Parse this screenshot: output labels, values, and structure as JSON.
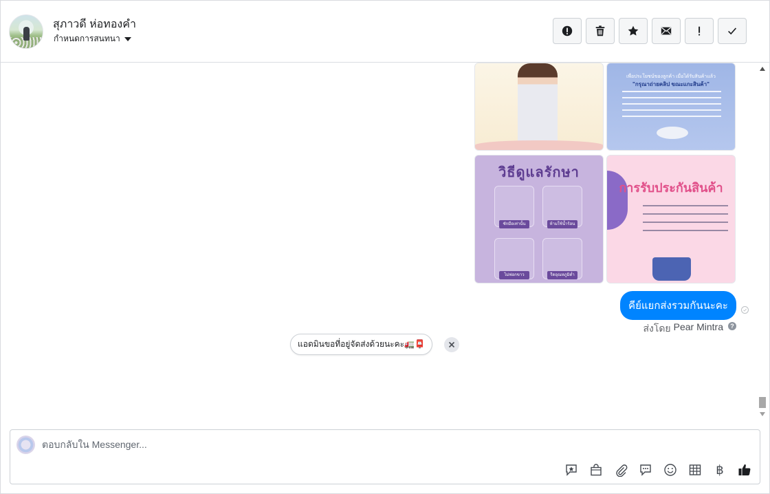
{
  "header": {
    "name": "สุภาวดี ห่อทองคำ",
    "subtitle": "กำหนดการสนทนา",
    "actions": [
      "info-icon",
      "trash-icon",
      "star-icon",
      "mail-icon",
      "exclamation-icon",
      "check-icon"
    ]
  },
  "conversation": {
    "images": {
      "img2_line1": "เพื่อประโยชน์ของลูกค้า เมื่อได้รับสินค้าแล้ว",
      "img2_line2": "\"กรุณาถ่ายคลิป ขณะแกะสินค้า\"",
      "img3_title": "วิธีดูแลรักษา",
      "img3_tags": [
        "ซักมือเท่านั้น",
        "ห้ามใช้น้ำร้อน",
        "ไม่ฟอกขาว",
        "รีดอุณหภูมิต่ำ"
      ],
      "img4_title": "การรับประกันสินค้า"
    },
    "outgoing_message": "คีย์แยกส่งรวมกันนะคะ",
    "sent_by_prefix": "ส่งโดย",
    "sent_by_name": "Pear Mintra",
    "help_glyph": "?",
    "suggestion": "แอดมินขอที่อยู่จัดส่งด้วยนะคะ🚛📮"
  },
  "composer": {
    "placeholder": "ตอบกลับใน Messenger...",
    "tools": [
      "saved-reply-icon",
      "shop-bag-icon",
      "attachment-icon",
      "message-icon",
      "emoji-icon",
      "table-icon",
      "baht-icon",
      "like-icon"
    ],
    "baht_symbol": "฿"
  },
  "colors": {
    "accent": "#0084ff",
    "border": "#ccd0d5",
    "muted_text": "#65676b"
  }
}
